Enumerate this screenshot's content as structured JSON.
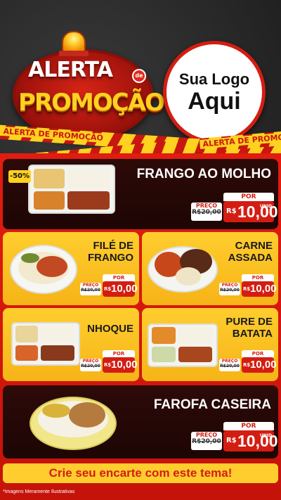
{
  "header": {
    "alerta": "ALERTA",
    "de": "de",
    "promocao": "PROMOÇÃO",
    "logo_line1": "Sua Logo",
    "logo_line2": "Aqui",
    "tape1_text": "ALERTA DE PROMOÇÃO",
    "tape2_text": "ALERTA DE PROMO"
  },
  "colors": {
    "red": "#d41d12",
    "yellow": "#ffcd2e",
    "dark": "#2d0a08"
  },
  "products": [
    {
      "title": "FRANGO AO MOLHO",
      "discount": "-50%",
      "por": "POR",
      "preco_label": "PREÇO",
      "old": "R$20,00",
      "currency": "R$",
      "price": "10,00",
      "unit": "UNID"
    },
    {
      "title_l1": "FILÉ DE",
      "title_l2": "FRANGO",
      "por": "POR",
      "preco_label": "PREÇO",
      "old": "R$20,00",
      "currency": "R$",
      "price": "10,00"
    },
    {
      "title_l1": "CARNE",
      "title_l2": "ASSADA",
      "por": "POR",
      "preco_label": "PREÇO",
      "old": "R$20,00",
      "currency": "R$",
      "price": "10,00"
    },
    {
      "title_l1": "NHOQUE",
      "por": "POR",
      "preco_label": "PREÇO",
      "old": "R$20,00",
      "currency": "R$",
      "price": "10,00"
    },
    {
      "title_l1": "PURE DE",
      "title_l2": "BATATA",
      "por": "POR",
      "preco_label": "PREÇO",
      "old": "R$20,00",
      "currency": "R$",
      "price": "10,00"
    },
    {
      "title": "FAROFA CASEIRA",
      "por": "POR",
      "preco_label": "PREÇO",
      "old": "R$20,00",
      "currency": "R$",
      "price": "10,00",
      "unit": "UNID"
    }
  ],
  "cta": "Crie seu encarte com este tema!",
  "footnote": "*Imagens Meramente Ilustrativas"
}
